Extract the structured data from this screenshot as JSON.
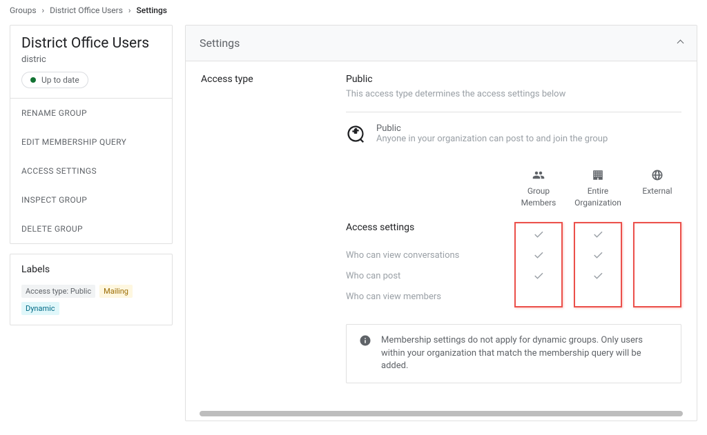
{
  "breadcrumbs": {
    "root": "Groups",
    "mid": "District Office Users",
    "current": "Settings"
  },
  "sidebar": {
    "group_name": "District Office Users",
    "email_prefix": "distric",
    "status": "Up to date",
    "menu": [
      "RENAME GROUP",
      "EDIT MEMBERSHIP QUERY",
      "ACCESS SETTINGS",
      "INSPECT GROUP",
      "DELETE GROUP"
    ],
    "labels_heading": "Labels",
    "chips": [
      {
        "t": "Access type: Public",
        "c": "gray"
      },
      {
        "t": "Mailing",
        "c": "yel"
      },
      {
        "t": "Dynamic",
        "c": "cy"
      }
    ]
  },
  "panel": {
    "title": "Settings",
    "row_label": "Access type",
    "access_type": "Public",
    "access_desc": "This access type determines the access settings below",
    "public_name": "Public",
    "public_desc": "Anyone in your organization can post to and join the group",
    "cols": [
      "Group Members",
      "Entire Organization",
      "External"
    ],
    "matrix_title": "Access settings",
    "matrix_rows": [
      "Who can view conversations",
      "Who can post",
      "Who can view members"
    ],
    "matrix": [
      [
        true,
        true,
        false
      ],
      [
        true,
        true,
        false
      ],
      [
        true,
        true,
        false
      ]
    ],
    "note": "Membership settings do not apply for dynamic groups. Only users within your organization that match the membership query will be added."
  }
}
